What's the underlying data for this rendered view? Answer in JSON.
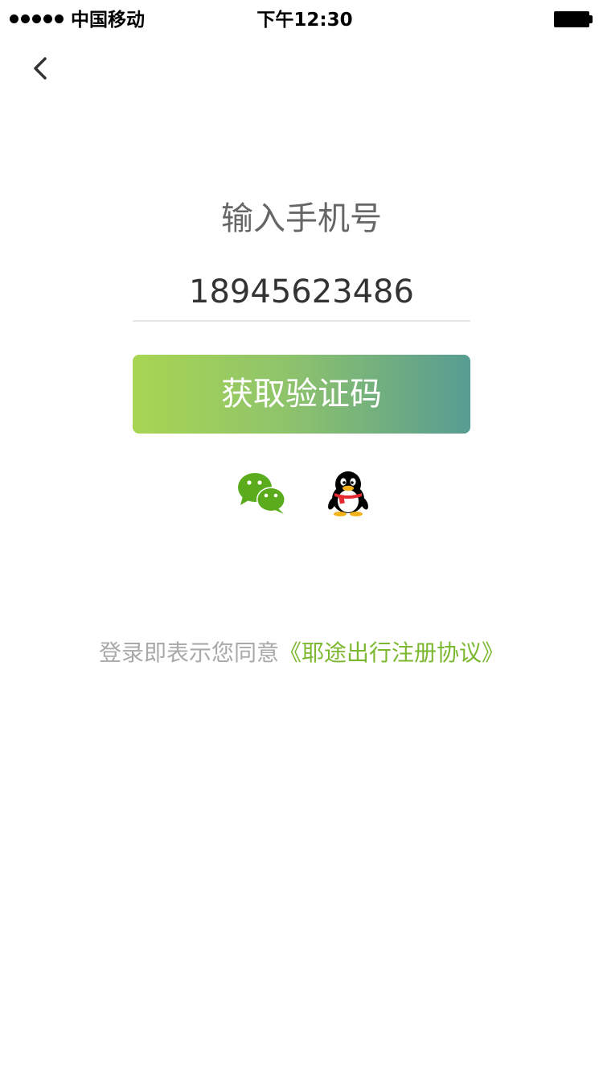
{
  "status_bar": {
    "carrier": "中国移动",
    "time": "下午12:30",
    "signal_bars": 5
  },
  "nav": {
    "back_icon": "chevron-left-icon"
  },
  "login": {
    "title": "输入手机号",
    "phone_value": "18945623486",
    "button_label": "获取验证码",
    "button_gradient": [
      "#a8d552",
      "#579c92"
    ]
  },
  "social": {
    "items": [
      {
        "name": "wechat-icon",
        "color": "#5aac1d"
      },
      {
        "name": "qq-icon",
        "color": "#000000"
      }
    ]
  },
  "agreement": {
    "prefix": "登录即表示您同意",
    "link_text": "《耶途出行注册协议》",
    "link_color": "#7cb82f"
  }
}
